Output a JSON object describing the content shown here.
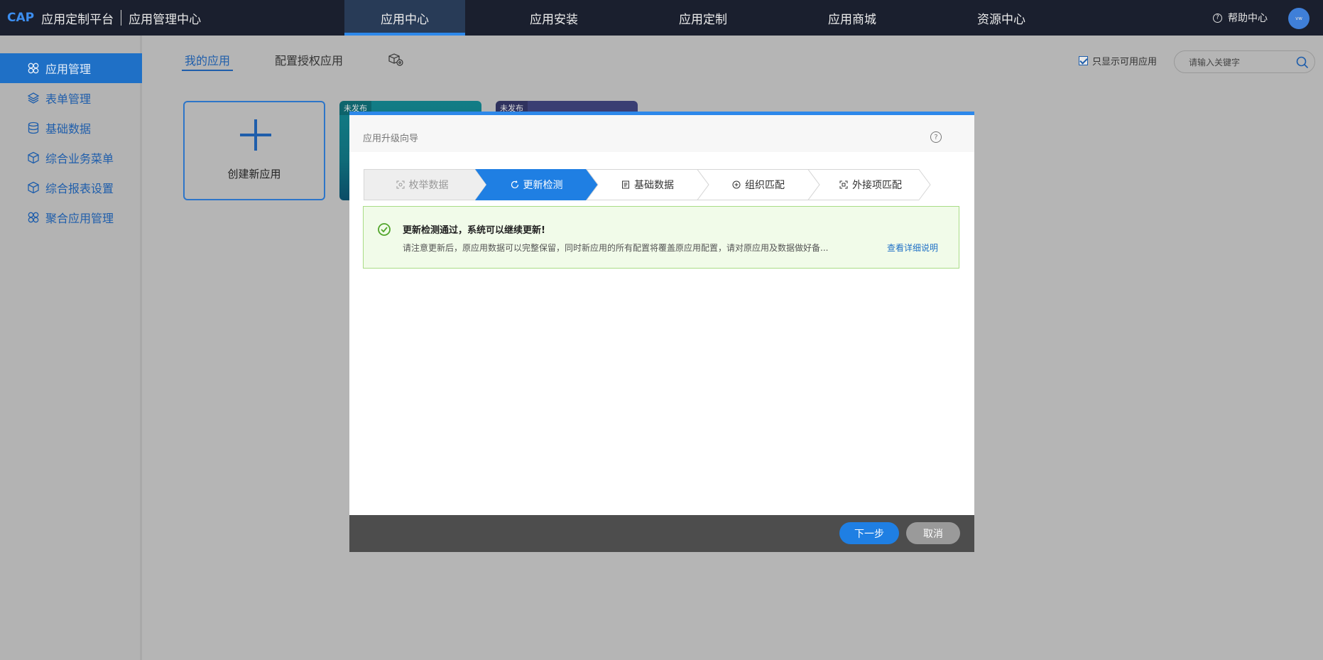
{
  "brand": {
    "logo": "CAP",
    "platform": "应用定制平台",
    "center": "应用管理中心"
  },
  "topnav": [
    {
      "label": "应用中心",
      "active": true
    },
    {
      "label": "应用安装"
    },
    {
      "label": "应用定制"
    },
    {
      "label": "应用商城"
    },
    {
      "label": "资源中心"
    }
  ],
  "header": {
    "help": "帮助中心",
    "avatar_text": "vw"
  },
  "sidebar": {
    "items": [
      {
        "label": "应用管理",
        "icon": "clover-icon",
        "active": true
      },
      {
        "label": "表单管理",
        "icon": "layers-icon"
      },
      {
        "label": "基础数据",
        "icon": "database-icon"
      },
      {
        "label": "综合业务菜单",
        "icon": "cube-icon"
      },
      {
        "label": "综合报表设置",
        "icon": "cube-icon"
      },
      {
        "label": "聚合应用管理",
        "icon": "clover-icon"
      }
    ]
  },
  "main": {
    "tabs": [
      {
        "label": "我的应用",
        "active": true
      },
      {
        "label": "配置授权应用"
      }
    ],
    "only_available": "只显示可用应用",
    "search_placeholder": "请输入关键字",
    "create_label": "创建新应用",
    "cards": [
      {
        "badge": "未发布"
      },
      {
        "badge": "未发布"
      }
    ]
  },
  "modal": {
    "title": "应用升级向导",
    "steps": [
      {
        "label": "枚举数据",
        "state": "done"
      },
      {
        "label": "更新检测",
        "state": "active"
      },
      {
        "label": "基础数据",
        "state": "todo"
      },
      {
        "label": "组织匹配",
        "state": "todo"
      },
      {
        "label": "外接项匹配",
        "state": "todo"
      }
    ],
    "alert": {
      "title": "更新检测通过，系统可以继续更新!",
      "desc": "请注意更新后，原应用数据可以完整保留，同时新应用的所有配置将覆盖原应用配置，请对原应用及数据做好备...",
      "link": "查看详细说明"
    },
    "buttons": {
      "next": "下一步",
      "cancel": "取消"
    }
  },
  "colors": {
    "accent": "#2d88ea",
    "nav_bg": "#1a1f2e",
    "success_bg": "#f1fbe9",
    "success_border": "#a9dc86"
  }
}
